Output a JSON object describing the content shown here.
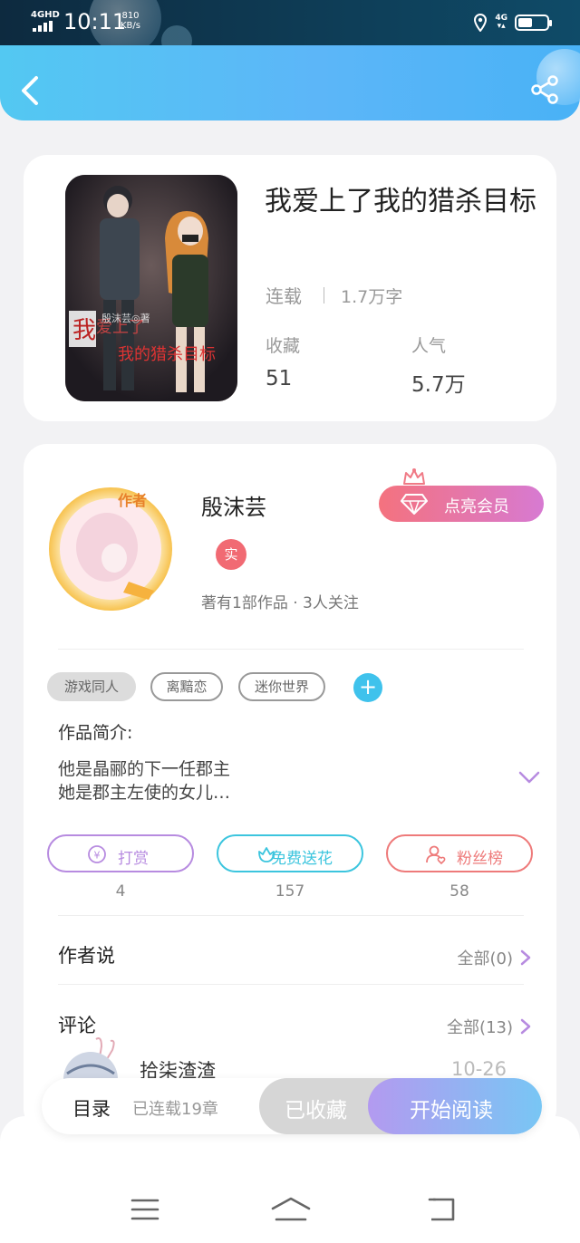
{
  "status_bar": {
    "network": "4GHD",
    "time": "10:11",
    "speed_value": "810",
    "speed_unit": "KB/s",
    "right_network": "4G"
  },
  "header": {
    "back_icon": "chevron-left-icon",
    "share_icon": "share-icon"
  },
  "book": {
    "title": "我爱上了我的猎杀目标",
    "status": "连载",
    "word_count": "1.7万字",
    "stats": [
      {
        "label": "收藏",
        "value": "51"
      },
      {
        "label": "人气",
        "value": "5.7万"
      }
    ]
  },
  "author": {
    "name": "殷沫芸",
    "verified_badge": "实",
    "meta": "著有1部作品 · 3人关注",
    "vip_button": "点亮会员"
  },
  "tags": [
    "游戏同人",
    "离黯恋",
    "迷你世界"
  ],
  "tag_add": "+",
  "intro": {
    "label": "作品简介:",
    "text": "他是晶郦的下一任郡主\n她是郡主左使的女儿…"
  },
  "actions": [
    {
      "label": "打赏",
      "count": "4",
      "icon": "coin-icon",
      "color": "#b78be0"
    },
    {
      "label": "免费送花",
      "count": "157",
      "icon": "flower-icon",
      "color": "#3cc5de"
    },
    {
      "label": "粉丝榜",
      "count": "58",
      "icon": "fan-icon",
      "color": "#ee7a7a"
    }
  ],
  "author_says": {
    "label": "作者说",
    "all": "全部(0)"
  },
  "comments": {
    "label": "评论",
    "all": "全部(13)",
    "first_user": "拾柒渣渣",
    "first_time": "10-26"
  },
  "read_bar": {
    "toc": "目录",
    "chapter_count": "已连载19章",
    "collected": "已收藏",
    "start_reading": "开始阅读"
  },
  "colors": {
    "header_accent": "#53c8f2",
    "purple_accent": "#b78be0"
  }
}
